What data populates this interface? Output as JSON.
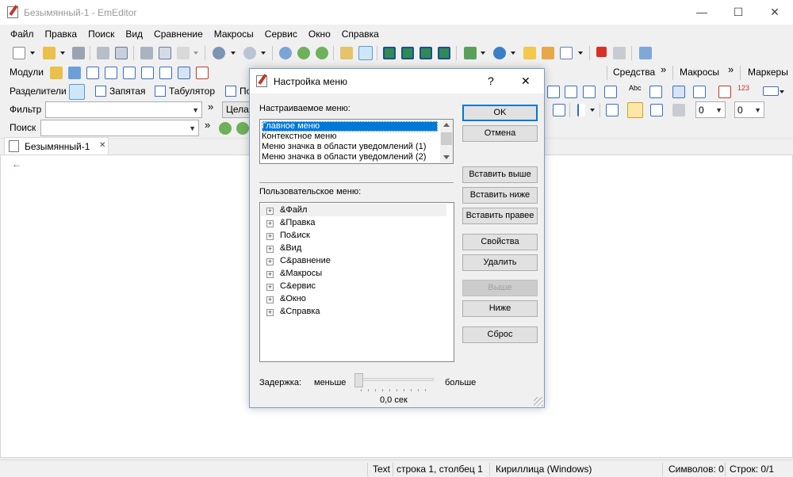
{
  "window": {
    "title": "Безымянный-1 - EmEditor",
    "minimize": "—",
    "maximize": "☐",
    "close": "✕"
  },
  "menu": [
    "Файл",
    "Правка",
    "Поиск",
    "Вид",
    "Сравнение",
    "Макросы",
    "Сервис",
    "Окно",
    "Справка"
  ],
  "toolbar2": {
    "modules": "Модули",
    "tools": "Средства",
    "macros": "Макросы",
    "markers": "Маркеры",
    "more": "»"
  },
  "toolbar3": {
    "separators": "Разделители",
    "comma": "Запятая",
    "tab": "Табулятор",
    "partial": "По",
    "abc": "Abc",
    "num": "123"
  },
  "toolbar4": {
    "filter": "Фильтр",
    "more": "»",
    "partial": "Целая",
    "combo1": "0",
    "combo2": "0"
  },
  "toolbar5": {
    "search": "Поиск",
    "more": "»"
  },
  "document_tab": {
    "name": "Безымянный-1",
    "close": "✕",
    "cursor_mark": "←"
  },
  "status": {
    "mode": "Text",
    "position": "строка 1, столбец 1",
    "encoding": "Кириллица (Windows)",
    "chars": "Символов: 0",
    "lines": "Строк: 0/1"
  },
  "dialog": {
    "title": "Настройка меню",
    "help": "?",
    "close": "✕",
    "custom_menu_label": "Настраиваемое меню:",
    "menus": [
      "Главное меню",
      "Контекстное меню",
      "Меню значка в области уведомлений (1)",
      "Меню значка в области уведомлений (2)"
    ],
    "user_menu_label": "Пользовательское меню:",
    "tree": [
      "&Файл",
      "&Правка",
      "По&иск",
      "&Вид",
      "С&равнение",
      "&Макросы",
      "С&ервис",
      "&Окно",
      "&Справка"
    ],
    "expand": "+",
    "buttons": {
      "ok": "OK",
      "cancel": "Отмена",
      "insert_above": "Вставить выше",
      "insert_below": "Вставить ниже",
      "insert_right": "Вставить правее",
      "properties": "Свойства",
      "delete": "Удалить",
      "up": "Выше",
      "down": "Ниже",
      "reset": "Сброс"
    },
    "delay_label": "Задержка:",
    "less": "меньше",
    "more": "больше",
    "delay_value": "0,0 сек",
    "delay_fraction": 0
  }
}
